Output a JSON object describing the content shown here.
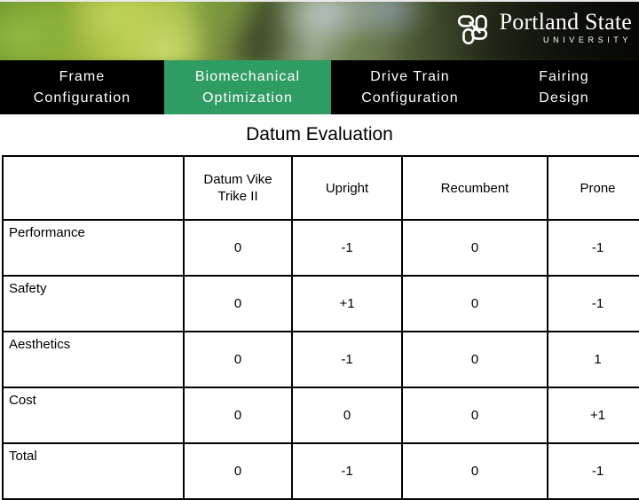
{
  "banner": {
    "logo": {
      "mark_name": "psu-knot-logo",
      "name": "Portland State",
      "subtitle": "UNIVERSITY"
    }
  },
  "nav": {
    "active_index": 1,
    "items": [
      {
        "line1": "Frame",
        "line2": "Configuration"
      },
      {
        "line1": "Biomechanical",
        "line2": "Optimization"
      },
      {
        "line1": "Drive Train",
        "line2": "Configuration"
      },
      {
        "line1": "Fairing",
        "line2": "Design"
      }
    ]
  },
  "colors": {
    "nav_background": "#000000",
    "nav_active": "#2f9c63",
    "nav_text": "#ffffff",
    "table_border": "#000000",
    "page_background": "#ffffff"
  },
  "section": {
    "title": "Datum Evaluation"
  },
  "chart_data": {
    "type": "table",
    "title": "Datum Evaluation",
    "corner_label": "",
    "columns": [
      "Datum Vike Trike II",
      "Upright",
      "Recumbent",
      "Prone"
    ],
    "column_lines": [
      [
        "Datum Vike",
        "Trike II"
      ],
      [
        "Upright"
      ],
      [
        "Recumbent"
      ],
      [
        "Prone"
      ]
    ],
    "categories": [
      "Performance",
      "Safety",
      "Aesthetics",
      "Cost",
      "Total"
    ],
    "rows": [
      {
        "label": "Performance",
        "values": [
          "0",
          "-1",
          "0",
          "-1"
        ]
      },
      {
        "label": "Safety",
        "values": [
          "0",
          "+1",
          "0",
          "-1"
        ]
      },
      {
        "label": "Aesthetics",
        "values": [
          "0",
          "-1",
          "0",
          "1"
        ]
      },
      {
        "label": "Cost",
        "values": [
          "0",
          "0",
          "0",
          "+1"
        ]
      },
      {
        "label": "Total",
        "values": [
          "0",
          "-1",
          "0",
          "-1"
        ]
      }
    ],
    "series": [
      {
        "name": "Datum Vike Trike II",
        "values": [
          0,
          0,
          0,
          0,
          0
        ]
      },
      {
        "name": "Upright",
        "values": [
          -1,
          1,
          -1,
          0,
          -1
        ]
      },
      {
        "name": "Recumbent",
        "values": [
          0,
          0,
          0,
          0,
          0
        ]
      },
      {
        "name": "Prone",
        "values": [
          -1,
          -1,
          1,
          1,
          -1
        ]
      }
    ]
  }
}
